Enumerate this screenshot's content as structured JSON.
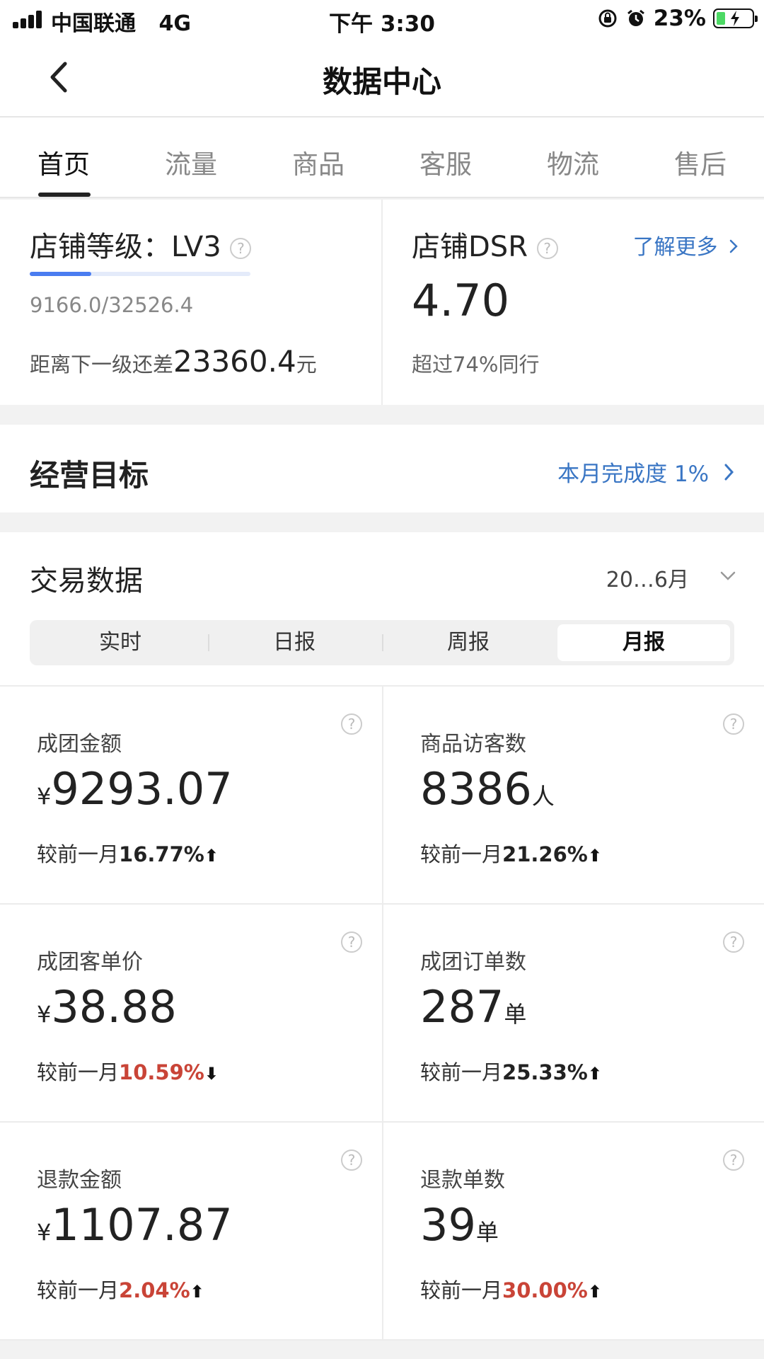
{
  "status_bar": {
    "carrier": "中国联通",
    "network": "4G",
    "time": "下午 3:30",
    "battery": "23%",
    "battery_level": 0.23
  },
  "nav": {
    "title": "数据中心"
  },
  "tabs": [
    {
      "label": "首页",
      "active": true
    },
    {
      "label": "流量",
      "active": false
    },
    {
      "label": "商品",
      "active": false
    },
    {
      "label": "客服",
      "active": false
    },
    {
      "label": "物流",
      "active": false
    },
    {
      "label": "售后",
      "active": false
    }
  ],
  "shop_level": {
    "title": "店铺等级：LV3",
    "score": "9166.0/32526.4",
    "progress_fraction": 0.28,
    "gap_prefix": "距离下一级还差",
    "gap_value": "23360.4",
    "gap_unit": "元"
  },
  "dsr": {
    "title": "店铺DSR",
    "more_link": "了解更多",
    "value": "4.70",
    "rank": "超过74%同行"
  },
  "goal": {
    "title": "经营目标",
    "progress": "本月完成度 1%"
  },
  "trade": {
    "title": "交易数据",
    "period": "20…6月",
    "segments": [
      {
        "label": "实时",
        "active": false
      },
      {
        "label": "日报",
        "active": false
      },
      {
        "label": "周报",
        "active": false
      },
      {
        "label": "月报",
        "active": true
      }
    ],
    "metrics": [
      {
        "label": "成团金额",
        "prefix": "¥",
        "value": "9293.07",
        "unit": "",
        "compare_label": "较前一月",
        "change": "16.77%",
        "direction": "up",
        "change_color": "#222222"
      },
      {
        "label": "商品访客数",
        "prefix": "",
        "value": "8386",
        "unit": "人",
        "compare_label": "较前一月",
        "change": "21.26%",
        "direction": "up",
        "change_color": "#222222"
      },
      {
        "label": "成团客单价",
        "prefix": "¥",
        "value": "38.88",
        "unit": "",
        "compare_label": "较前一月",
        "change": "10.59%",
        "direction": "down",
        "change_color": "#c94437"
      },
      {
        "label": "成团订单数",
        "prefix": "",
        "value": "287",
        "unit": "单",
        "compare_label": "较前一月",
        "change": "25.33%",
        "direction": "up",
        "change_color": "#222222"
      },
      {
        "label": "退款金额",
        "prefix": "¥",
        "value": "1107.87",
        "unit": "",
        "compare_label": "较前一月",
        "change": "2.04%",
        "direction": "up",
        "change_color": "#c94437"
      },
      {
        "label": "退款单数",
        "prefix": "",
        "value": "39",
        "unit": "单",
        "compare_label": "较前一月",
        "change": "30.00%",
        "direction": "up",
        "change_color": "#c94437"
      }
    ]
  },
  "icons": {
    "back": "chevron-left-icon",
    "help": "question-circle-icon",
    "more_chevron": "chevron-right-icon",
    "period_chevron": "chevron-down-icon",
    "trend_up": "arrow-up-icon",
    "trend_down": "arrow-down-icon"
  },
  "colors": {
    "link": "#3a76c4",
    "negative": "#c94437",
    "progress": "#4a7cf0"
  }
}
